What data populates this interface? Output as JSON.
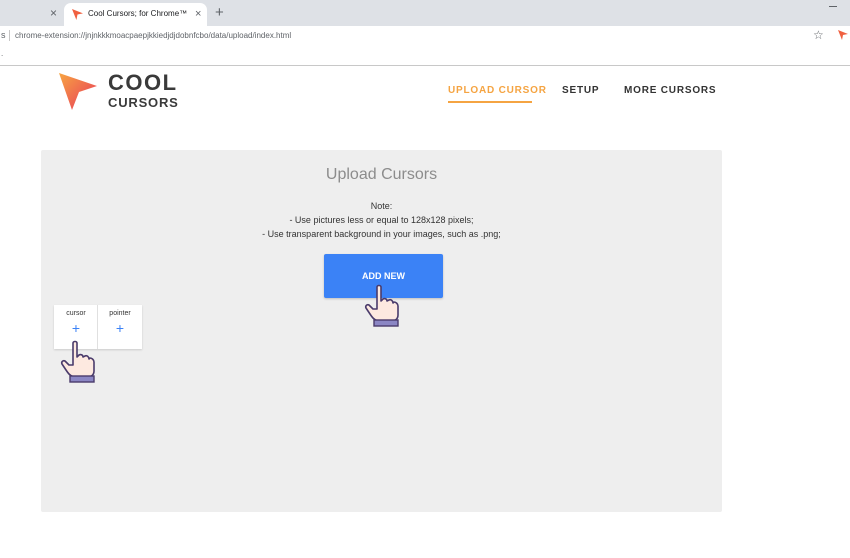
{
  "browser": {
    "prev_tab_close": "×",
    "tab_title": "Cool Cursors; for Chrome™",
    "tab_close": "×",
    "new_tab": "+",
    "nav_fragment": "s",
    "url": "chrome-extension://jnjnkkkmoacpaepjkkiedjdjdobnfcbo/data/upload/index.html",
    "star": "☆",
    "bookmark_fragment": "."
  },
  "logo": {
    "line1": "COOL",
    "line2": "CURSORS"
  },
  "nav": {
    "upload": "UPLOAD CURSOR",
    "setup": "SETUP",
    "more": "MORE CURSORS"
  },
  "panel": {
    "title": "Upload Cursors",
    "note_heading": "Note:",
    "note_line1": "- Use pictures less or equal to 128x128 pixels;",
    "note_line2": "- Use transparent background in your images, such as .png;",
    "add_new": "ADD NEW",
    "slots": [
      {
        "label": "cursor",
        "plus": "+"
      },
      {
        "label": "pointer",
        "plus": "+"
      }
    ]
  },
  "colors": {
    "accent": "#f5a442",
    "button": "#3b82f6",
    "panel": "#eeeeee"
  }
}
